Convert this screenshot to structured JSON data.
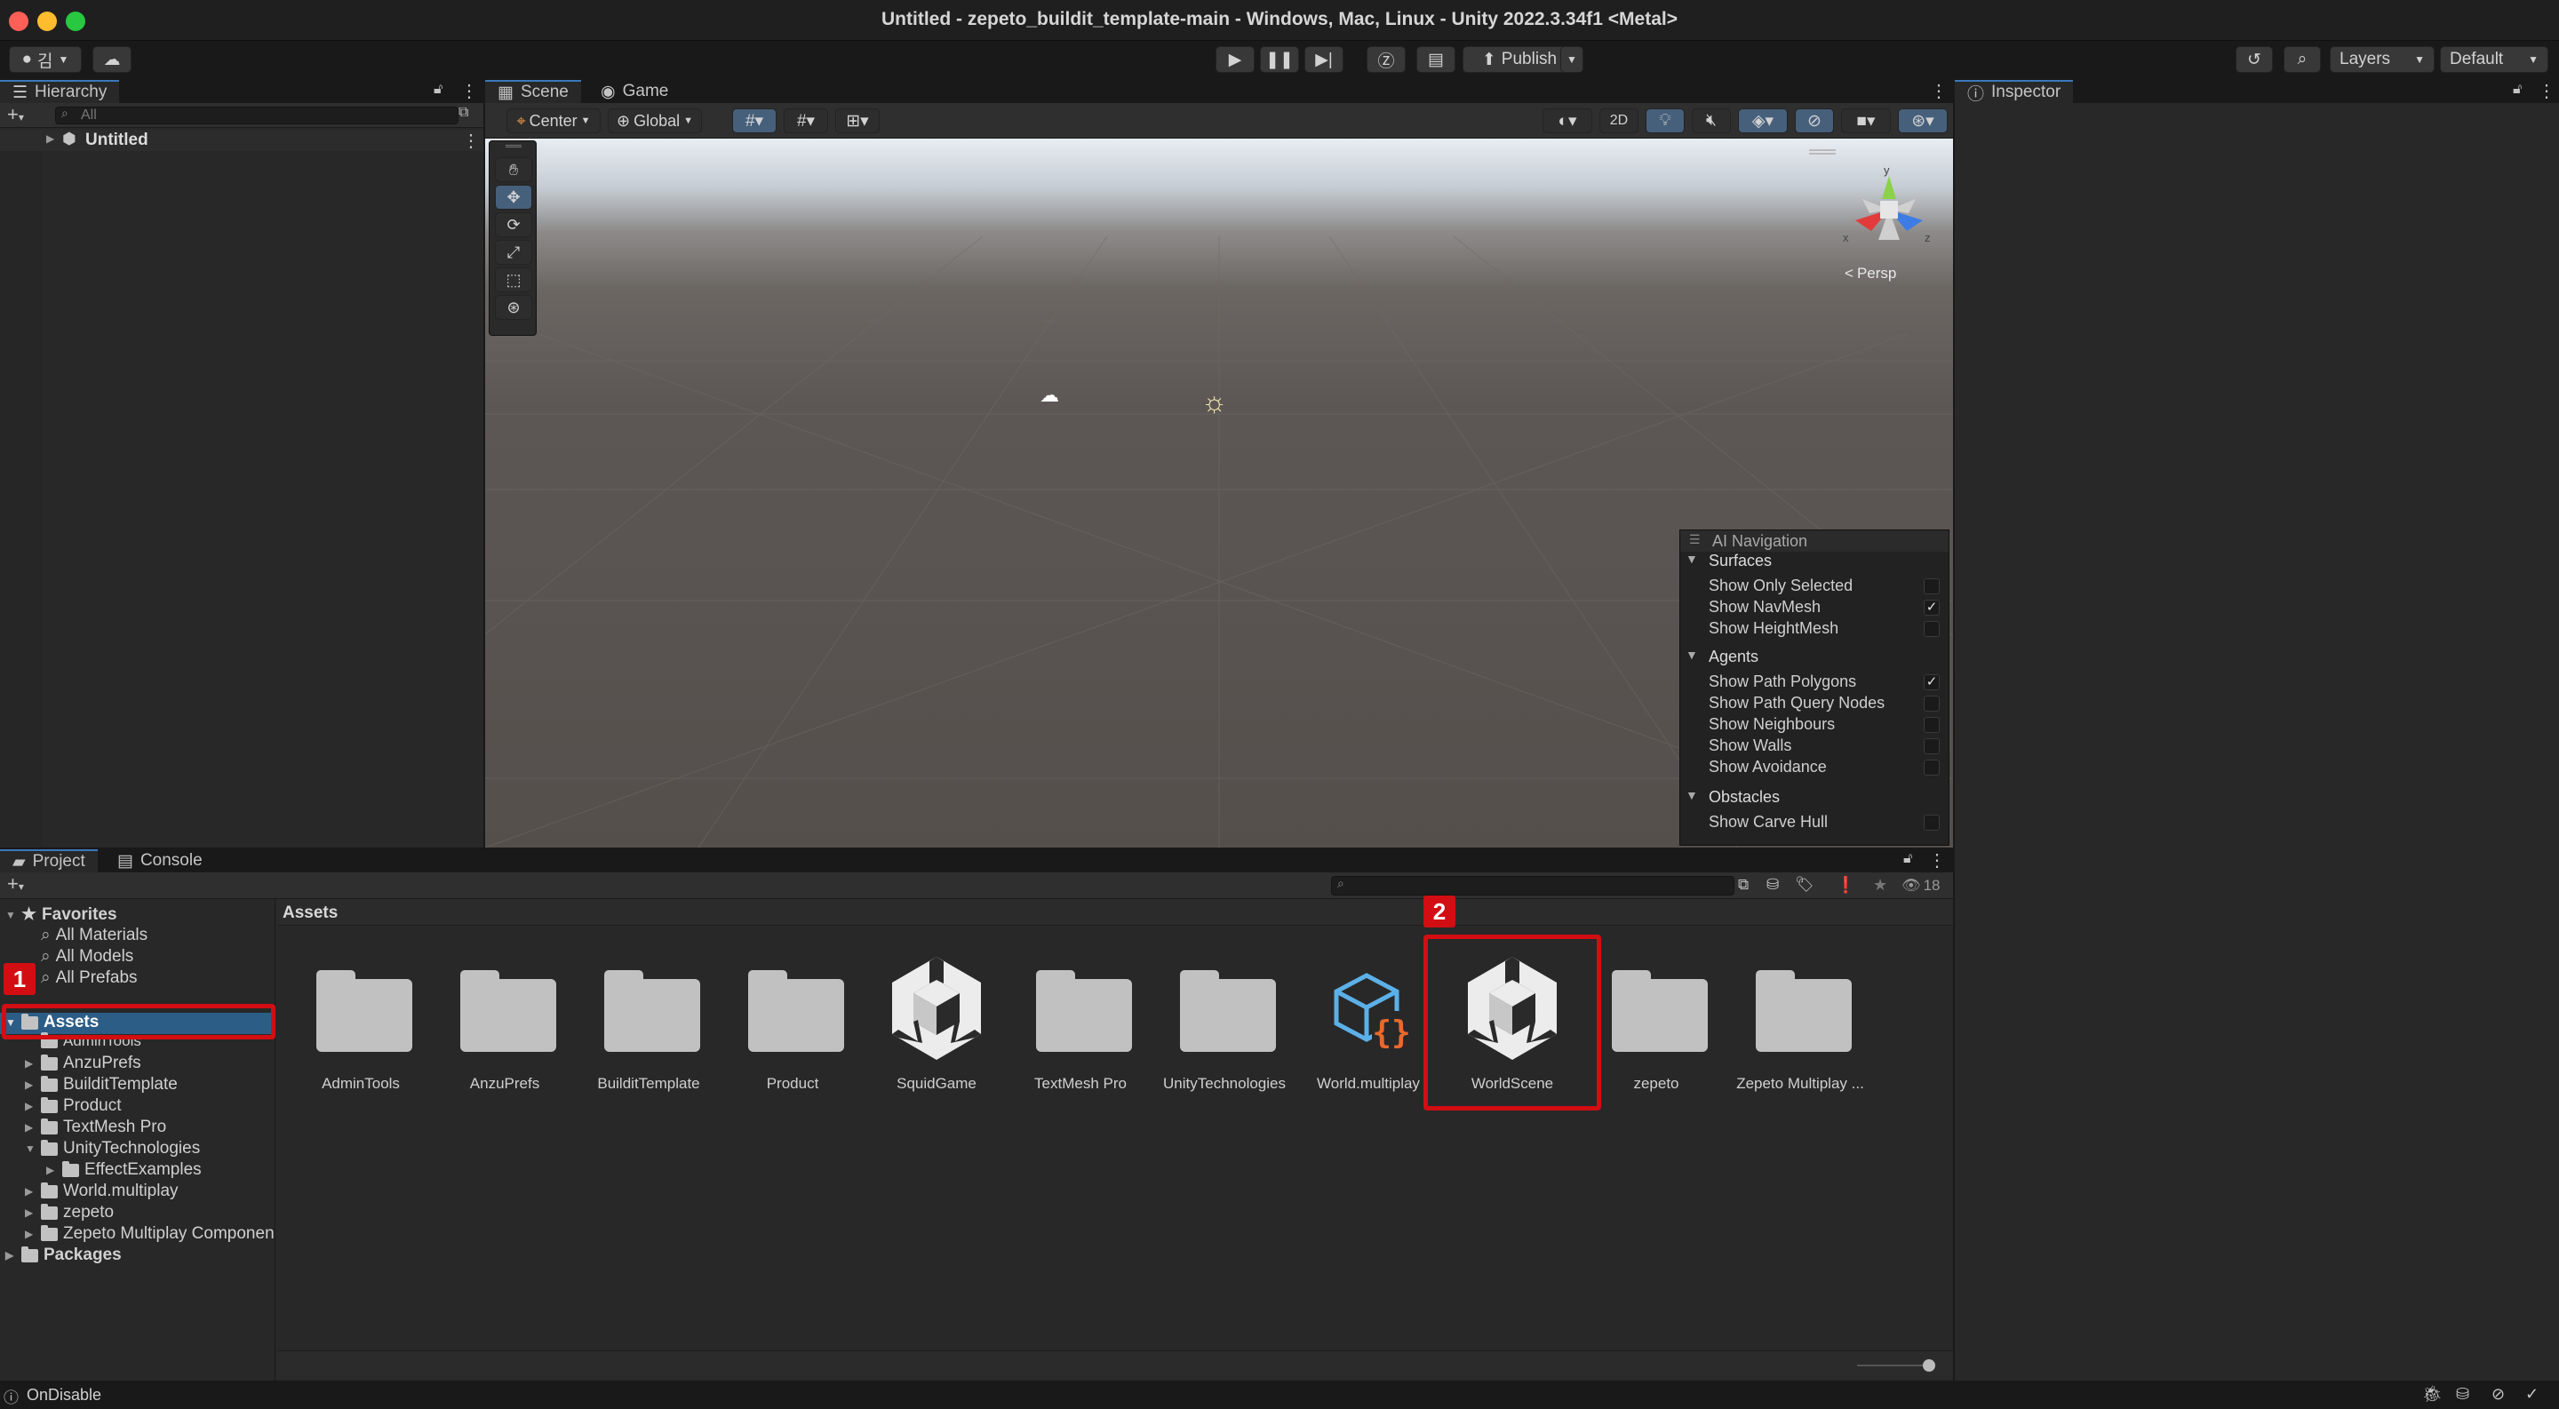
{
  "window": {
    "title": "Untitled - zepeto_buildit_template-main - Windows, Mac, Linux - Unity 2022.3.34f1 <Metal>"
  },
  "toolbar": {
    "account_initial": "김",
    "publish_label": "Publish",
    "layers_label": "Layers",
    "layout_label": "Default"
  },
  "hierarchy": {
    "tab_label": "Hierarchy",
    "search_placeholder": "All",
    "scene_name": "Untitled"
  },
  "scene": {
    "tabs": [
      "Scene",
      "Game"
    ],
    "pivot_label": "Center",
    "space_label": "Global",
    "mode_2d_label": "2D",
    "persp_label": "Persp",
    "gizmo_axes": {
      "x": "x",
      "y": "y",
      "z": "z"
    }
  },
  "ai_navigation": {
    "title": "AI Navigation",
    "sections": [
      {
        "header": "Surfaces",
        "items": [
          {
            "label": "Show Only Selected",
            "checked": false
          },
          {
            "label": "Show NavMesh",
            "checked": true
          },
          {
            "label": "Show HeightMesh",
            "checked": false
          }
        ]
      },
      {
        "header": "Agents",
        "items": [
          {
            "label": "Show Path Polygons",
            "checked": true
          },
          {
            "label": "Show Path Query Nodes",
            "checked": false
          },
          {
            "label": "Show Neighbours",
            "checked": false
          },
          {
            "label": "Show Walls",
            "checked": false
          },
          {
            "label": "Show Avoidance",
            "checked": false
          }
        ]
      },
      {
        "header": "Obstacles",
        "items": [
          {
            "label": "Show Carve Hull",
            "checked": false
          }
        ]
      }
    ]
  },
  "inspector": {
    "tab_label": "Inspector"
  },
  "project": {
    "tabs": [
      "Project",
      "Console"
    ],
    "hidden_count": "18",
    "breadcrumb": "Assets",
    "favorites": {
      "label": "Favorites",
      "items": [
        "All Materials",
        "All Models",
        "All Prefabs"
      ]
    },
    "tree": {
      "assets_label": "Assets",
      "children": [
        "AdminTools",
        "AnzuPrefs",
        "BuilditTemplate",
        "Product",
        "TextMesh Pro",
        "UnityTechnologies",
        "EffectExamples",
        "World.multiplay",
        "zepeto",
        "Zepeto Multiplay Componen"
      ],
      "packages_label": "Packages"
    },
    "assets": [
      {
        "name": "AdminTools",
        "type": "folder"
      },
      {
        "name": "AnzuPrefs",
        "type": "folder"
      },
      {
        "name": "BuilditTemplate",
        "type": "folder"
      },
      {
        "name": "Product",
        "type": "folder"
      },
      {
        "name": "SquidGame",
        "type": "scene"
      },
      {
        "name": "TextMesh Pro",
        "type": "folder"
      },
      {
        "name": "UnityTechnologies",
        "type": "folder"
      },
      {
        "name": "World.multiplay",
        "type": "script"
      },
      {
        "name": "WorldScene",
        "type": "scene"
      },
      {
        "name": "zepeto",
        "type": "folder"
      },
      {
        "name": "Zepeto Multiplay ...",
        "type": "folder"
      }
    ]
  },
  "annotations": {
    "step1": "1",
    "step2": "2",
    "color": "#d20e12"
  },
  "status": {
    "message": "OnDisable"
  }
}
